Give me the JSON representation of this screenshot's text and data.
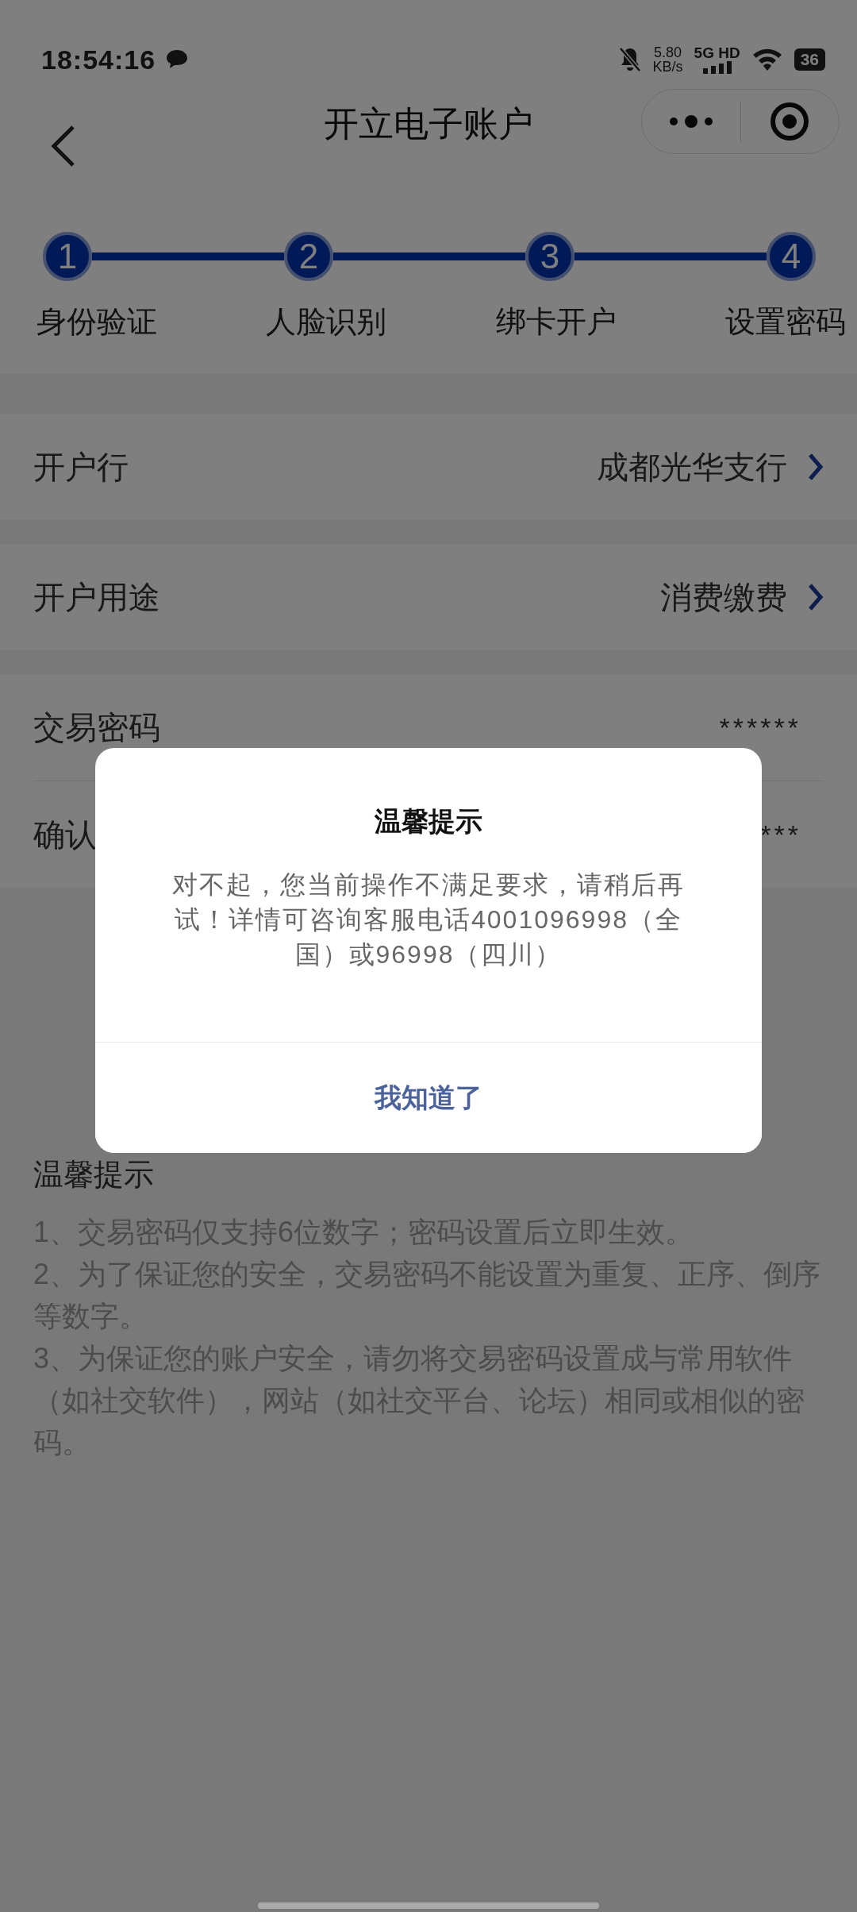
{
  "status_bar": {
    "time": "18:54:16",
    "speed_value": "5.80",
    "speed_unit": "KB/s",
    "network": "5G HD",
    "battery": "36"
  },
  "nav": {
    "title": "开立电子账户"
  },
  "steps": [
    {
      "number": "1",
      "label": "身份验证",
      "active": true
    },
    {
      "number": "2",
      "label": "人脸识别",
      "active": true
    },
    {
      "number": "3",
      "label": "绑卡开户",
      "active": true
    },
    {
      "number": "4",
      "label": "设置密码",
      "active": true
    }
  ],
  "form": [
    {
      "kind": "select",
      "label": "开户行",
      "value": "成都光华支行"
    },
    {
      "kind": "select",
      "label": "开户用途",
      "value": "消费缴费"
    },
    {
      "kind": "password",
      "label": "交易密码",
      "value": "******"
    },
    {
      "kind": "password",
      "label": "确认",
      "value": "***"
    }
  ],
  "tips": {
    "title": "温馨提示",
    "items": [
      "1、交易密码仅支持6位数字；密码设置后立即生效。",
      "2、为了保证您的安全，交易密码不能设置为重复、正序、倒序等数字。",
      "3、为保证您的账户安全，请勿将交易密码设置成与常用软件（如社交软件），网站（如社交平台、论坛）相同或相似的密码。"
    ]
  },
  "dialog": {
    "title": "温馨提示",
    "message": "对不起，您当前操作不满足要求，请稍后再试！详情可咨询客服电话4001096998（全国）或96998（四川）",
    "button": "我知道了"
  }
}
